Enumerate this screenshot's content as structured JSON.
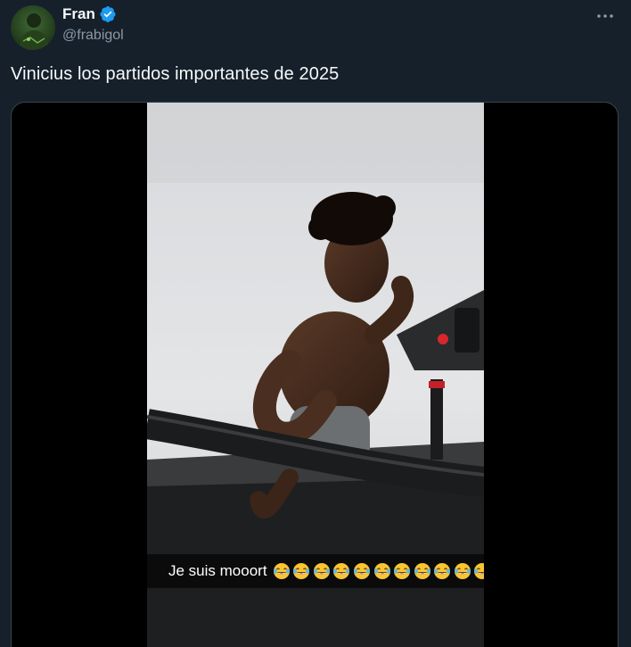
{
  "tweet": {
    "author": {
      "display_name": "Fran",
      "handle": "@frabigol",
      "verified": true,
      "avatar_icon": "profile-avatar"
    },
    "more_icon": "more-horizontal-icon",
    "text": "Vinicius los partidos importantes de 2025",
    "media": {
      "type": "video",
      "caption": "Je suis mooort",
      "caption_emoji": "😂",
      "caption_emoji_count": 11
    }
  },
  "colors": {
    "background": "#15202b",
    "text_primary": "#f7f9f9",
    "text_secondary": "#8b98a5",
    "verified": "#1d9bf0",
    "media_border": "#38444d"
  }
}
